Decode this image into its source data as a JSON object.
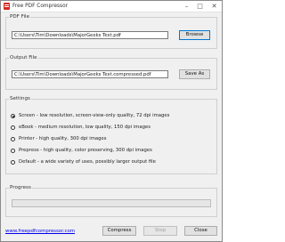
{
  "window": {
    "title": "Free PDF Compressor"
  },
  "pdf_file": {
    "group_label": "PDF File",
    "path": "C:\\Users\\Tim\\Downloads\\MajorGeeks Test.pdf",
    "browse_label": "Browse"
  },
  "output_file": {
    "group_label": "Output File",
    "path": "C:\\Users\\Tim\\Downloads\\MajorGeeks Test.compressed.pdf",
    "save_as_label": "Save As"
  },
  "settings": {
    "group_label": "Settings",
    "selected_index": 0,
    "options": [
      "Screen - low resolution, screen-view-only quality, 72 dpi images",
      "eBook - medium resolution, low quality, 150 dpi images",
      "Printer - high quality, 300 dpi images",
      "Prepress - high quality, color preserving, 300 dpi images",
      "Default - a wide variety of uses, possibly larger output file"
    ]
  },
  "progress": {
    "group_label": "Progress",
    "percent": 0
  },
  "footer": {
    "link_text": "www.freepdfcompressor.com",
    "compress_label": "Compress",
    "stop_label": "Stop",
    "close_label": "Close"
  }
}
